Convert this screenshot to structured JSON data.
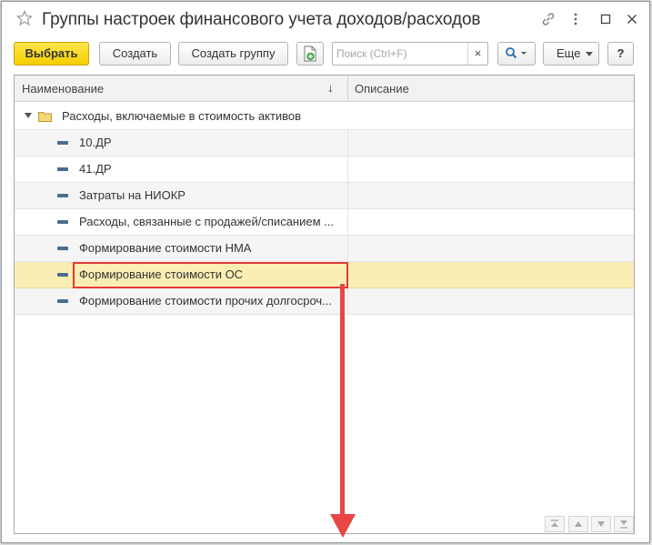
{
  "window": {
    "title": "Группы настроек финансового учета доходов/расходов"
  },
  "toolbar": {
    "select_label": "Выбрать",
    "create_label": "Создать",
    "create_group_label": "Создать группу",
    "search_placeholder": "Поиск (Ctrl+F)",
    "search_clear": "×",
    "more_label": "Еще",
    "help_label": "?"
  },
  "table": {
    "columns": [
      "Наименование",
      "Описание"
    ],
    "sort_indicator": "↓",
    "group": {
      "label": "Расходы, включаемые в стоимость активов"
    },
    "rows": [
      {
        "name": "10.ДР",
        "description": ""
      },
      {
        "name": "41.ДР",
        "description": ""
      },
      {
        "name": "Затраты на НИОКР",
        "description": ""
      },
      {
        "name": "Расходы, связанные с продажей/списанием ...",
        "description": ""
      },
      {
        "name": "Формирование стоимости НМА",
        "description": ""
      },
      {
        "name": "Формирование стоимости ОС",
        "description": ""
      },
      {
        "name": "Формирование стоимости прочих долгосроч...",
        "description": ""
      }
    ],
    "selected_row_index": 5
  },
  "colors": {
    "accent_button": "#f5ce00",
    "selected_row": "#fbeeb4",
    "annotation": "#e84545"
  }
}
